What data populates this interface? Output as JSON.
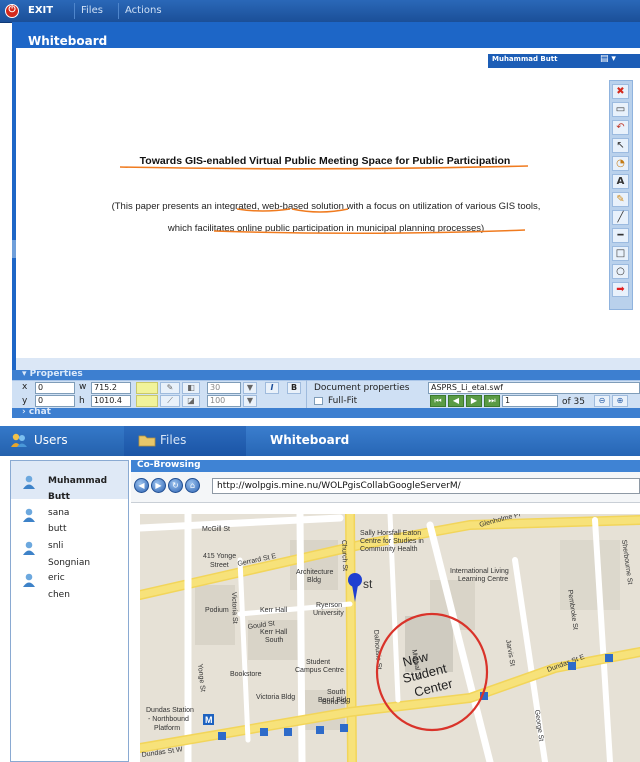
{
  "menu": {
    "exit": "EXIT",
    "files": "Files",
    "actions": "Actions"
  },
  "whiteboard": {
    "title": "Whiteboard",
    "user_tag": "Muhammad Butt",
    "doc_title": "Towards GIS-enabled Virtual Public Meeting Space for Public Participation",
    "doc_body": "(This paper presents an integrated, web-based solution with a focus on utilization of various GIS tools, which facilitates online public participation in municipal planning processes)",
    "tools": [
      "close-icon",
      "page-icon",
      "undo-icon",
      "pointer-icon",
      "zoom-icon",
      "text-icon",
      "pencil-icon",
      "line-icon",
      "highlight-line-icon",
      "rectangle-icon",
      "ellipse-icon",
      "arrow-icon"
    ]
  },
  "properties": {
    "title": "Properties",
    "x_label": "x",
    "x_value": "0",
    "y_label": "y",
    "y_value": "0",
    "w_label": "w",
    "w_value": "715.2",
    "h_label": "h",
    "h_value": "1010.4",
    "font_size": "30",
    "opacity": "100",
    "italic": "I",
    "bold": "B",
    "doc_props_label": "Document properties",
    "doc_file": "ASPRS_Li_etal.swf",
    "fullfit": "Full-Fit",
    "page_value": "1",
    "page_of": "of 35"
  },
  "chat": {
    "label": "chat"
  },
  "tabs": {
    "users": "Users",
    "files": "Files",
    "whiteboard": "Whiteboard"
  },
  "users": [
    {
      "first": "Muhammad",
      "last": "Butt"
    },
    {
      "first": "sana",
      "last": "butt"
    },
    {
      "first": "snli",
      "last": "Songnian"
    },
    {
      "first": "eric",
      "last": "chen"
    }
  ],
  "cobrowse": {
    "title": "Co-Browsing",
    "url": "http://wolpgis.mine.nu/WOLPgisCollabGoogleServerM/"
  },
  "map": {
    "streets": [
      "McGill St",
      "Gerrard St E",
      "Church St",
      "Jarvis St",
      "Yonge St",
      "Gould St",
      "Dundas St E",
      "Victoria St",
      "Dalhousie St",
      "George St",
      "Pembroke St",
      "Sherbourne St",
      "Glenholme Pl",
      "Mutual St",
      "Dundas St W",
      "Bond St"
    ],
    "places": [
      "415 Yonge Street",
      "Sally Horsfall Eaton Centre for Studies in Community Health",
      "Architecture Bldg",
      "International Living Learning Centre",
      "Podium",
      "Kerr Hall",
      "Ryerson University",
      "Kerr Hall South",
      "Student Campus Centre",
      "Bookstore",
      "Victoria Bldg",
      "South Bond Bldg",
      "Dundas Station - Northbound Platform"
    ],
    "annotation": "New Student Center",
    "marker_suffix": "st"
  },
  "colors": {
    "frame_blue": "#1d66c7",
    "accent_orange": "#f07b1f",
    "annotation_red": "#d9332a"
  }
}
